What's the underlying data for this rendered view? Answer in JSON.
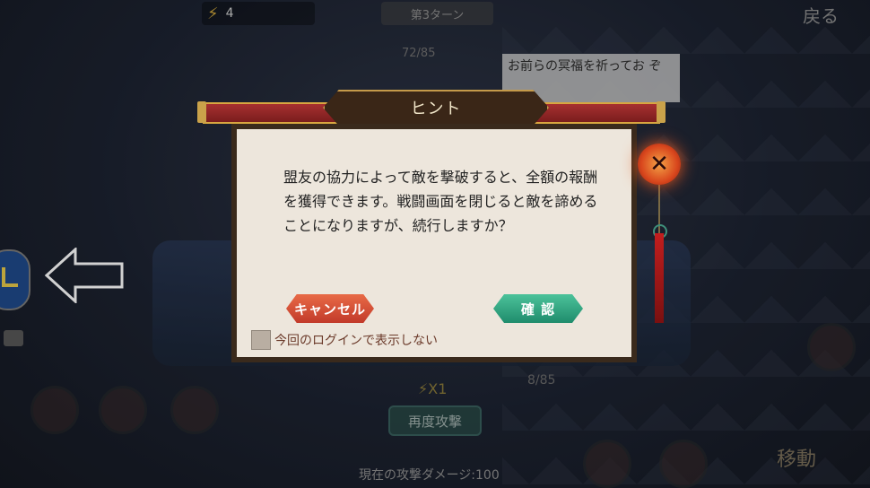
{
  "background": {
    "energy_value": "4",
    "turn_label": "第3ターン",
    "top_hp": "72/85",
    "speech_bubble": "お前らの冥福を祈ってお ぞ",
    "logo_text": "戻る",
    "hp_mid": "8/85",
    "x1_label": "X1",
    "attack_button": "再度攻撃",
    "damage_label": "現在の攻撃ダメージ:100",
    "move_label": "移動"
  },
  "dialog": {
    "title": "ヒント",
    "message": "盟友の協力によって敵を撃破すると、全額の報酬を獲得できます。戦闘画面を閉じると敵を諦めることになりますが、続行しますか？",
    "cancel_label": "キャンセル",
    "confirm_label": "確 認",
    "checkbox_label": "今回のログインで表示しない",
    "close_icon": "close-icon"
  },
  "colors": {
    "cancel": "#d24a33",
    "confirm": "#2fa47f",
    "dialog_bg": "#ede6dc",
    "scroll_red": "#a73030"
  }
}
